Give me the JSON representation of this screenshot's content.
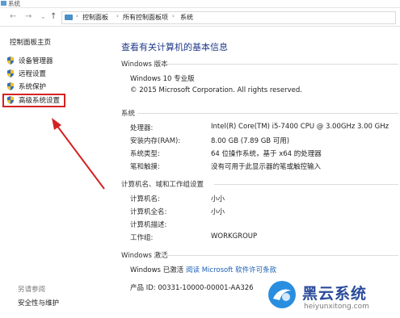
{
  "window": {
    "title": "系统"
  },
  "nav": {
    "back_glyph": "←",
    "forward_glyph": "→",
    "recent_glyph": "⌄",
    "up_glyph": "↑",
    "breadcrumb": [
      "控制面板",
      "所有控制面板项",
      "系统"
    ],
    "separator": "›"
  },
  "sidebar": {
    "home": "控制面板主页",
    "items": [
      {
        "label": "设备管理器",
        "icon": "shield-icon"
      },
      {
        "label": "远程设置",
        "icon": "shield-icon"
      },
      {
        "label": "系统保护",
        "icon": "shield-icon"
      },
      {
        "label": "高级系统设置",
        "icon": "shield-icon"
      }
    ],
    "see_also": "另请参阅",
    "security": "安全性与维护"
  },
  "main": {
    "page_title": "查看有关计算机的基本信息",
    "edition": {
      "heading": "Windows 版本",
      "name": "Windows 10 专业版",
      "copyright": "© 2015 Microsoft Corporation. All rights reserved."
    },
    "system": {
      "heading": "系统",
      "rows": [
        {
          "label": "处理器:",
          "value": "Intel(R) Core(TM) i5-7400 CPU @ 3.00GHz   3.00 GHz"
        },
        {
          "label": "安装内存(RAM):",
          "value": "8.00 GB (7.89 GB 可用)"
        },
        {
          "label": "系统类型:",
          "value": "64 位操作系统，基于 x64 的处理器"
        },
        {
          "label": "笔和触摸:",
          "value": "没有可用于此显示器的笔或触控输入"
        }
      ]
    },
    "computer": {
      "heading": "计算机名、域和工作组设置",
      "rows": [
        {
          "label": "计算机名:",
          "value": "小小"
        },
        {
          "label": "计算机全名:",
          "value": "小小"
        },
        {
          "label": "计算机描述:",
          "value": ""
        },
        {
          "label": "工作组:",
          "value": "WORKGROUP"
        }
      ]
    },
    "activation": {
      "heading": "Windows 激活",
      "status": "Windows 已激活",
      "license_link": "阅读 Microsoft 软件许可条款",
      "product_id": "产品 ID: 00331-10000-00001-AA326"
    }
  },
  "watermark": {
    "name": "黑云系统",
    "url": "heiyunxitong.com"
  },
  "colors": {
    "annotation_red": "#d42222",
    "title_blue": "#1e3a8a",
    "link_blue": "#1a5fb4",
    "shield_blue": "#2f6fc6",
    "shield_yellow": "#f2c11d"
  }
}
